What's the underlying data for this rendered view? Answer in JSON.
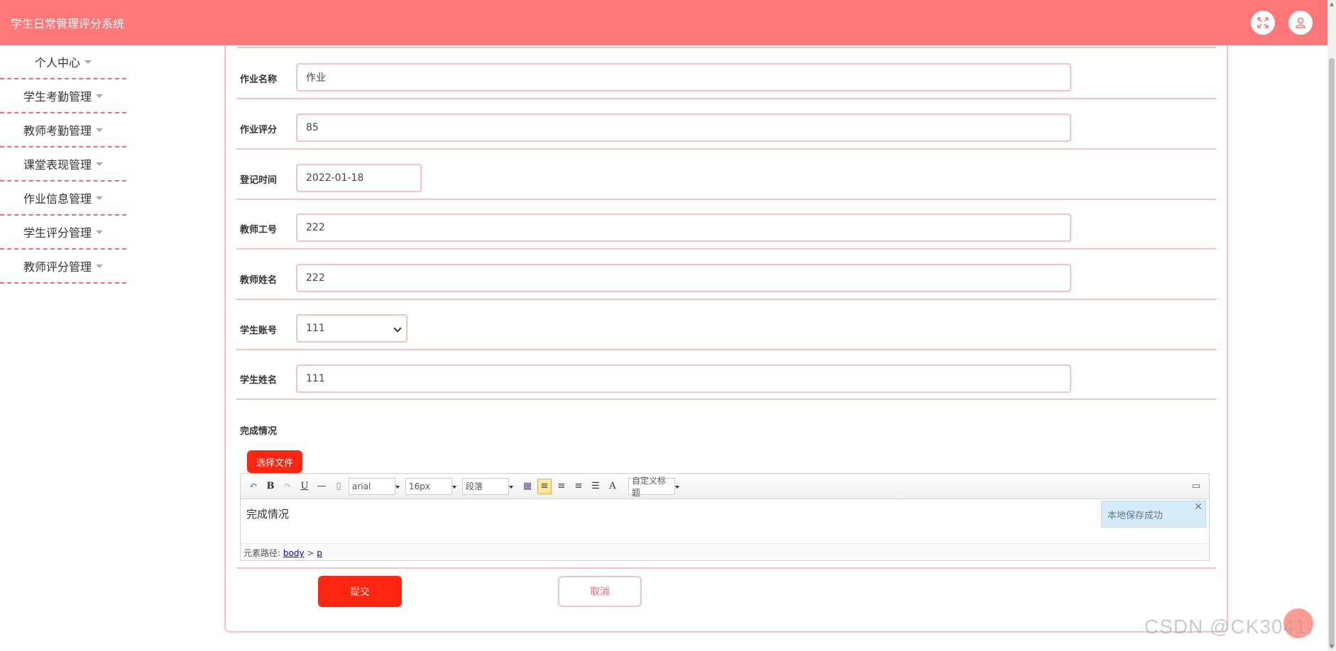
{
  "header": {
    "title": "学生日常管理评分系统",
    "fullscreen_icon": "expand-icon",
    "user_icon": "user-icon"
  },
  "sidebar": {
    "items": [
      {
        "label": "个人中心"
      },
      {
        "label": "学生考勤管理"
      },
      {
        "label": "教师考勤管理"
      },
      {
        "label": "课堂表现管理"
      },
      {
        "label": "作业信息管理"
      },
      {
        "label": "学生评分管理"
      },
      {
        "label": "教师评分管理"
      }
    ]
  },
  "form": {
    "homework_name": {
      "label": "作业名称",
      "value": "作业"
    },
    "homework_score": {
      "label": "作业评分",
      "value": "85"
    },
    "record_time": {
      "label": "登记时间",
      "value": "2022-01-18"
    },
    "teacher_id": {
      "label": "教师工号",
      "value": "222"
    },
    "teacher_name": {
      "label": "教师姓名",
      "value": "222"
    },
    "student_account": {
      "label": "学生账号",
      "value": "111"
    },
    "student_name": {
      "label": "学生姓名",
      "value": "111"
    },
    "completion": {
      "label": "完成情况"
    }
  },
  "editor": {
    "file_button": "选择文件",
    "font_family": "arial",
    "font_size": "16px",
    "paragraph": "段落",
    "custom_title": "自定义标题",
    "content": "完成情况",
    "toast": "本地保存成功",
    "toast_close": "✕",
    "path_label": "元素路径:",
    "path_body": "body",
    "path_sep": ">",
    "path_p": "p"
  },
  "actions": {
    "submit": "提交",
    "cancel": "取消"
  },
  "watermark": "CSDN @CK3041",
  "colors": {
    "header": "#fe7778",
    "primary_button": "#fe2611",
    "border": "#f8c1c2",
    "sidebar_divider": "#f46675"
  }
}
